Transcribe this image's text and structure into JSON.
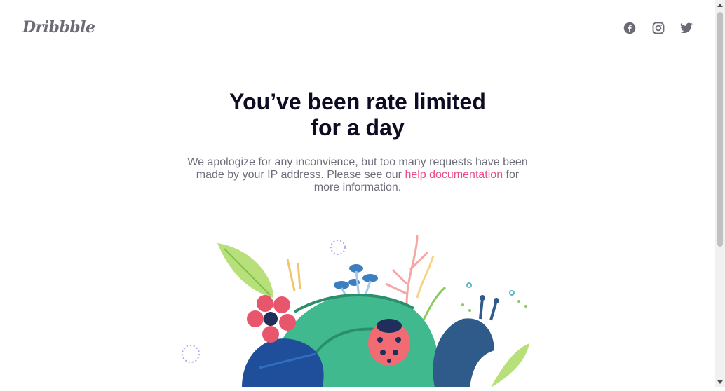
{
  "header": {
    "logo_text": "Dribbble",
    "social": [
      {
        "name": "facebook-icon"
      },
      {
        "name": "instagram-icon"
      },
      {
        "name": "twitter-icon"
      }
    ]
  },
  "main": {
    "title_line1": "You’ve been rate limited",
    "title_line2": "for a day",
    "description_before": "We apologize for any inconvience, but too many requests have been made by your IP address. Please see our ",
    "link_text": "help documentation",
    "description_after": " for more information."
  },
  "colors": {
    "title": "#0d0c22",
    "text": "#6e6d7a",
    "link": "#ea4c89"
  }
}
